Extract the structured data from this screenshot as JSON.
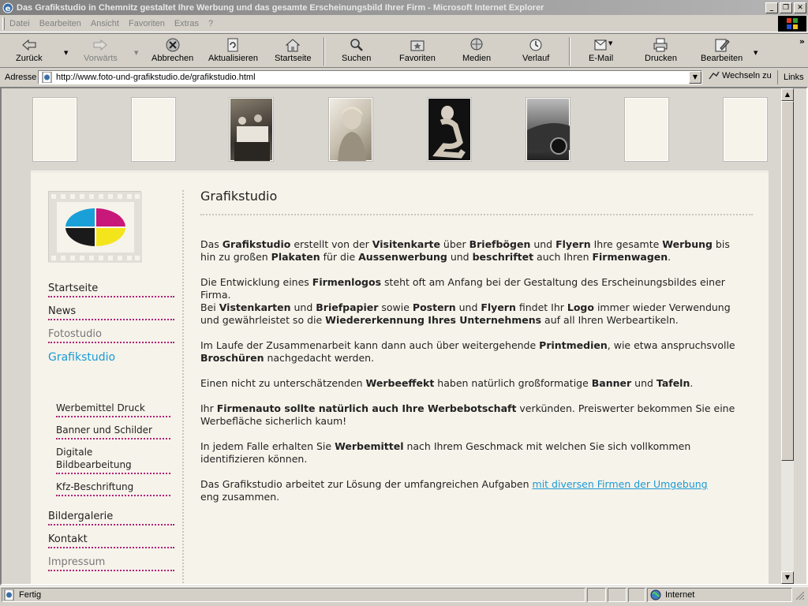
{
  "window": {
    "title": "Das Grafikstudio in Chemnitz gestaltet Ihre Werbung und das gesamte Erscheinungsbild Ihrer Firm - Microsoft Internet Explorer",
    "min": "_",
    "max": "❐",
    "close": "✕"
  },
  "menu": [
    "Datei",
    "Bearbeiten",
    "Ansicht",
    "Favoriten",
    "Extras",
    "?"
  ],
  "toolbar": {
    "back": "Zurück",
    "forward": "Vorwärts",
    "stop": "Abbrechen",
    "refresh": "Aktualisieren",
    "home": "Startseite",
    "search": "Suchen",
    "favorites": "Favoriten",
    "media": "Medien",
    "history": "Verlauf",
    "mail": "E-Mail",
    "print": "Drucken",
    "edit": "Bearbeiten",
    "more": "»"
  },
  "address": {
    "label": "Adresse",
    "url": "http://www.foto-und-grafikstudio.de/grafikstudio.html",
    "go": "Wechseln zu",
    "links": "Links"
  },
  "nav": {
    "items": [
      "Startseite",
      "News",
      "Fotostudio",
      "Grafikstudio"
    ],
    "sub": [
      "Werbemittel Druck",
      "Banner und Schilder",
      "Digitale Bildbearbeitung",
      "Kfz-Beschriftung"
    ],
    "bottom": [
      "Bildergalerie",
      "Kontakt",
      "Impressum"
    ]
  },
  "main": {
    "title": "Grafikstudio",
    "link_text": "mit diversen Firmen der Umgebung",
    "link_after": "eng zusammen.",
    "link_before": "Das Grafikstudio arbeitet zur Lösung der umfangreichen Aufgaben "
  },
  "status": {
    "left": "Fertig",
    "zone": "Internet"
  }
}
